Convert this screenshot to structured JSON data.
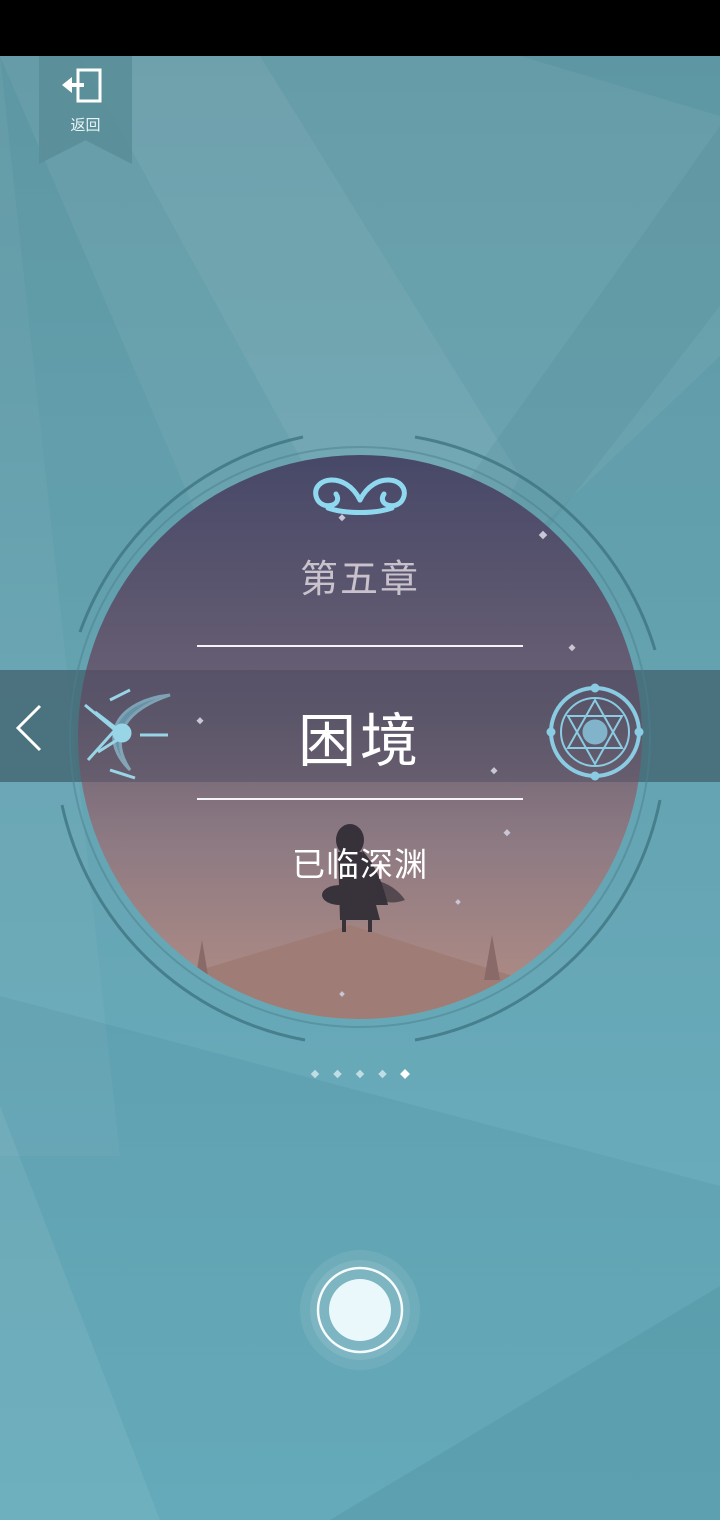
{
  "header": {
    "back_label": "返回",
    "back_icon": "exit-icon"
  },
  "chapter": {
    "number_label": "第五章",
    "title": "困境",
    "subtitle": "已临深渊"
  },
  "navigation": {
    "prev_icon": "chevron-left-icon",
    "page_count": 5,
    "current_page": 5
  },
  "colors": {
    "background": "#6aa8b5",
    "band": "#446773",
    "disc_top": "#474a68",
    "disc_bottom": "#b58f86",
    "accent": "#8fd9f0"
  }
}
